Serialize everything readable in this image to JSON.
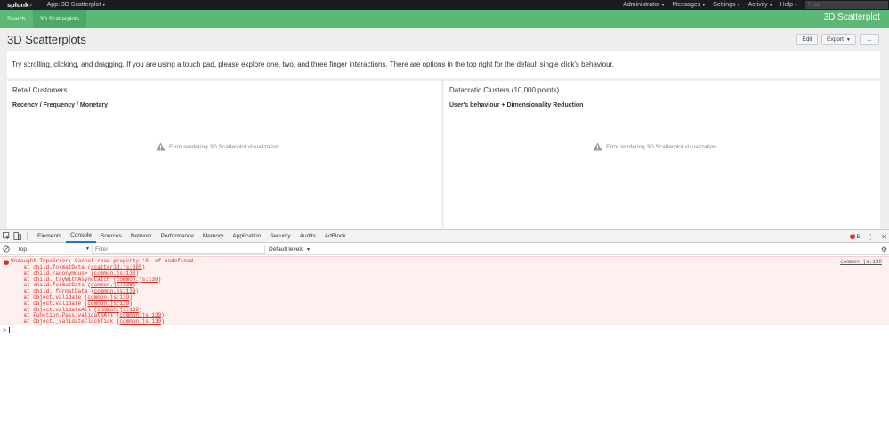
{
  "topbar": {
    "logo": "splunk",
    "logo_gt": ">",
    "app_menu": "App: 3D Scatterplot",
    "menu": [
      "Administrator",
      "Messages",
      "Settings",
      "Activity",
      "Help"
    ],
    "find_placeholder": "Find"
  },
  "appbar": {
    "nav": [
      "Search",
      "3D Scatterplots"
    ],
    "active_index": 1,
    "title": "3D Scatterplot",
    "color": "#5cb874"
  },
  "dashboard": {
    "title": "3D Scatterplots",
    "buttons": {
      "edit": "Edit",
      "export": "Export",
      "more": "..."
    },
    "description": "Try scrolling, clicking, and dragging. If you are using a touch pad, please explore one, two, and three finger interactions. There are options in the top right for the default single click's behaviour.",
    "panels": [
      {
        "title": "Retail Customers",
        "subtitle": "Recency / Frequency / Monetary",
        "error": "Error rendering 3D Scatterplot visualization."
      },
      {
        "title": "Datacratic Clusters (10,000 points)",
        "subtitle": "User's behaviour + Dimensionality Reduction",
        "error": "Error rendering 3D Scatterplot visualization."
      }
    ]
  },
  "devtools": {
    "tabs": [
      "Elements",
      "Console",
      "Sources",
      "Network",
      "Performance",
      "Memory",
      "Application",
      "Security",
      "Audits",
      "AdBlock"
    ],
    "active_tab": "Console",
    "error_count": "5",
    "context": "top",
    "filter_placeholder": "Filter",
    "levels": "Default levels",
    "error": {
      "message": "Uncaught TypeError: Cannot read property '0' of undefined",
      "source": "common.js:138",
      "stack": [
        {
          "fn": "    at child.formatData (",
          "file": "scatter3d.js:385",
          "end": ")"
        },
        {
          "fn": "    at child.<anonymous> (",
          "file": "common.js:138",
          "end": ")"
        },
        {
          "fn": "    at child._tryWithAsyncCatch (",
          "file": "common.js:138",
          "end": ")"
        },
        {
          "fn": "    at child.formatData (",
          "file": "common.js:138",
          "end": ")"
        },
        {
          "fn": "    at child._formatData (",
          "file": "common.js:139",
          "end": ")"
        },
        {
          "fn": "    at Object.validate (",
          "file": "common.js:139",
          "end": ")"
        },
        {
          "fn": "    at Object.validate (",
          "file": "common.js:139",
          "end": ")"
        },
        {
          "fn": "    at Object.validateAll (",
          "file": "common.js:139",
          "end": ")"
        },
        {
          "fn": "    at Function.Pass.validateAll (",
          "file": "common.js:139",
          "end": ")"
        },
        {
          "fn": "    at Object._validateClockTick (",
          "file": "common.js:139",
          "end": ")"
        }
      ]
    },
    "prompt": ">"
  }
}
